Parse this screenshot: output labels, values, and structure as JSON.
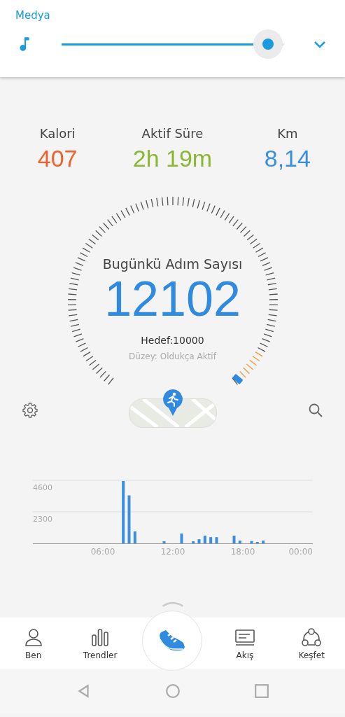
{
  "media": {
    "title": "Medya",
    "volume": {
      "level": 0.93
    }
  },
  "stats": [
    {
      "label": "Kalori",
      "value": "407",
      "color": "#f0622d"
    },
    {
      "label": "Aktif Süre",
      "value": "2h 19m",
      "color": "#8ab734"
    },
    {
      "label": "Km",
      "value": "8,14",
      "color": "#3a8ee0"
    }
  ],
  "steps": {
    "title": "Bugünkü Adım Sayısı",
    "count": "12102",
    "goal": "Hedef:10000",
    "level_text": "Düzey: Oldukça Aktif"
  },
  "chart": {
    "chart_data": {
      "type": "bar",
      "x": [
        7.75,
        8.25,
        8.75,
        11.25,
        12.75,
        13.75,
        14.25,
        14.75,
        15.25,
        15.75,
        17.25,
        17.75,
        18.75,
        19.25,
        19.75
      ],
      "series": [
        {
          "color": "#3a8ee0",
          "values": [
            4550,
            3500,
            870,
            150,
            720,
            150,
            300,
            560,
            450,
            450,
            560,
            200,
            170,
            100,
            200
          ]
        }
      ],
      "xlim": [
        0,
        24
      ],
      "ylim": [
        0,
        4600
      ],
      "xticks": [
        {
          "value": 6,
          "label": "06:00"
        },
        {
          "value": 12,
          "label": "12:00"
        },
        {
          "value": 18,
          "label": "18:00"
        },
        {
          "value": 24,
          "label": "00:00"
        }
      ],
      "yticks": [
        2300,
        4600
      ]
    }
  },
  "nav": [
    {
      "kind": "person",
      "label": "Ben"
    },
    {
      "kind": "bars",
      "label": "Trendler"
    },
    {
      "kind": "shoe"
    },
    {
      "kind": "feed",
      "label": "Akış"
    },
    {
      "kind": "explore",
      "label": "Keşfet"
    }
  ]
}
